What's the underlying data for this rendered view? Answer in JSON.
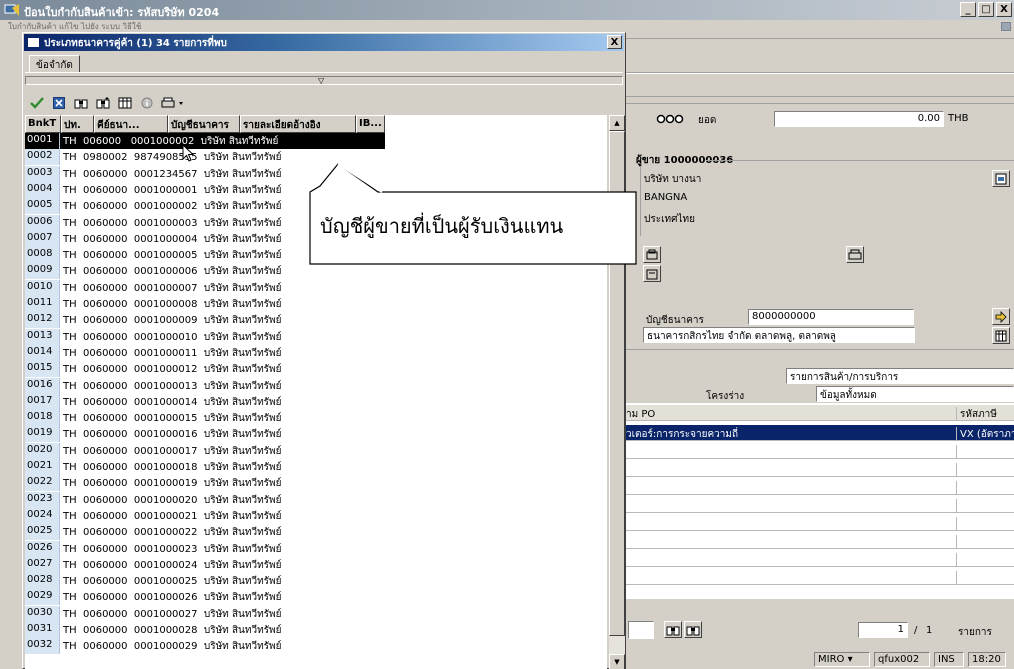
{
  "window": {
    "title": "ป้อนใบกำกับสินค้าเข้า: รหัสบริษัท 0204",
    "menu_text": "ใบกำกับสินค้า  แก้ไข  ไปยัง  ระบบ  วิธีใช้",
    "minimize": "_",
    "maximize": "□",
    "close": "X"
  },
  "background": {
    "balance_label": "ยอด",
    "balance_value": "0.00",
    "currency": "THB",
    "vendor_heading": "ผู้ขาย 1000000036",
    "vendor_name": "บริษัท บางนา",
    "vendor_city": "BANGNA",
    "vendor_country": "ประเทศไทย",
    "bank_account_label": "บัญชีธนาคาร",
    "bank_account_value": "8000000000",
    "bank_name": "ธนาคารกสิกรไทย จำกัด  ตลาดพลู, ตลาดพลู",
    "item_list_label": "รายการสินค้า/การบริการ",
    "layout_label": "โครงร่าง",
    "layout_value": "ข้อมูลทั้งหมด",
    "grid_col1": "าม PO",
    "grid_col2": "รหัสภาษี",
    "grid_row1_col1": "วเตอร์:การกระจายความถี่",
    "grid_row1_col2": "VX (อัตราภา",
    "page_current": "1",
    "page_sep": "/",
    "page_total": "1",
    "page_unit": "รายการ"
  },
  "status_bar": {
    "system": "MIRO",
    "client": "qfux002",
    "mode": "INS",
    "time": "18:20"
  },
  "dialog": {
    "title": "ประเภทธนาคารคู่ค้า (1)  34 รายการที่พบ",
    "close": "X",
    "tab_label": "ข้อจำกัด",
    "columns": [
      "BnkT",
      "ปท.",
      "คีย์ธนา...",
      "บัญชีธนาคาร",
      "รายละเอียดอ้างอิง",
      "IB..."
    ],
    "rows": [
      {
        "key": "0001",
        "rest": "TH  006000   0001000002  บริษัท สินทวีทรัพย์"
      },
      {
        "key": "0002",
        "rest": "TH  0980002  9874908555  บริษัท สินทวีทรัพย์"
      },
      {
        "key": "0003",
        "rest": "TH  0060000  0001234567  บริษัท สินทวีทรัพย์"
      },
      {
        "key": "0004",
        "rest": "TH  0060000  0001000001  บริษัท สินทวีทรัพย์"
      },
      {
        "key": "0005",
        "rest": "TH  0060000  0001000002  บริษัท สินทวีทรัพย์"
      },
      {
        "key": "0006",
        "rest": "TH  0060000  0001000003  บริษัท สินทวีทรัพย์"
      },
      {
        "key": "0007",
        "rest": "TH  0060000  0001000004  บริษัท สินทวีทรัพย์"
      },
      {
        "key": "0008",
        "rest": "TH  0060000  0001000005  บริษัท สินทวีทรัพย์"
      },
      {
        "key": "0009",
        "rest": "TH  0060000  0001000006  บริษัท สินทวีทรัพย์"
      },
      {
        "key": "0010",
        "rest": "TH  0060000  0001000007  บริษัท สินทวีทรัพย์"
      },
      {
        "key": "0011",
        "rest": "TH  0060000  0001000008  บริษัท สินทวีทรัพย์"
      },
      {
        "key": "0012",
        "rest": "TH  0060000  0001000009  บริษัท สินทวีทรัพย์"
      },
      {
        "key": "0013",
        "rest": "TH  0060000  0001000010  บริษัท สินทวีทรัพย์"
      },
      {
        "key": "0014",
        "rest": "TH  0060000  0001000011  บริษัท สินทวีทรัพย์"
      },
      {
        "key": "0015",
        "rest": "TH  0060000  0001000012  บริษัท สินทวีทรัพย์"
      },
      {
        "key": "0016",
        "rest": "TH  0060000  0001000013  บริษัท สินทวีทรัพย์"
      },
      {
        "key": "0017",
        "rest": "TH  0060000  0001000014  บริษัท สินทวีทรัพย์"
      },
      {
        "key": "0018",
        "rest": "TH  0060000  0001000015  บริษัท สินทวีทรัพย์"
      },
      {
        "key": "0019",
        "rest": "TH  0060000  0001000016  บริษัท สินทวีทรัพย์"
      },
      {
        "key": "0020",
        "rest": "TH  0060000  0001000017  บริษัท สินทวีทรัพย์"
      },
      {
        "key": "0021",
        "rest": "TH  0060000  0001000018  บริษัท สินทวีทรัพย์"
      },
      {
        "key": "0022",
        "rest": "TH  0060000  0001000019  บริษัท สินทวีทรัพย์"
      },
      {
        "key": "0023",
        "rest": "TH  0060000  0001000020  บริษัท สินทวีทรัพย์"
      },
      {
        "key": "0024",
        "rest": "TH  0060000  0001000021  บริษัท สินทวีทรัพย์"
      },
      {
        "key": "0025",
        "rest": "TH  0060000  0001000022  บริษัท สินทวีทรัพย์"
      },
      {
        "key": "0026",
        "rest": "TH  0060000  0001000023  บริษัท สินทวีทรัพย์"
      },
      {
        "key": "0027",
        "rest": "TH  0060000  0001000024  บริษัท สินทวีทรัพย์"
      },
      {
        "key": "0028",
        "rest": "TH  0060000  0001000025  บริษัท สินทวีทรัพย์"
      },
      {
        "key": "0029",
        "rest": "TH  0060000  0001000026  บริษัท สินทวีทรัพย์"
      },
      {
        "key": "0030",
        "rest": "TH  0060000  0001000027  บริษัท สินทวีทรัพย์"
      },
      {
        "key": "0031",
        "rest": "TH  0060000  0001000028  บริษัท สินทวีทรัพย์"
      },
      {
        "key": "0032",
        "rest": "TH  0060000  0001000029  บริษัท สินทวีทรัพย์"
      }
    ]
  },
  "callout": {
    "text": "บัญชีผู้ขายที่เป็นผู้รับเงินแทน"
  },
  "colors": {
    "selection": "#000000",
    "key_column_bg": "#d8e6f4",
    "dialog_title_start": "#0a246a",
    "dialog_title_end": "#a6caf0"
  }
}
